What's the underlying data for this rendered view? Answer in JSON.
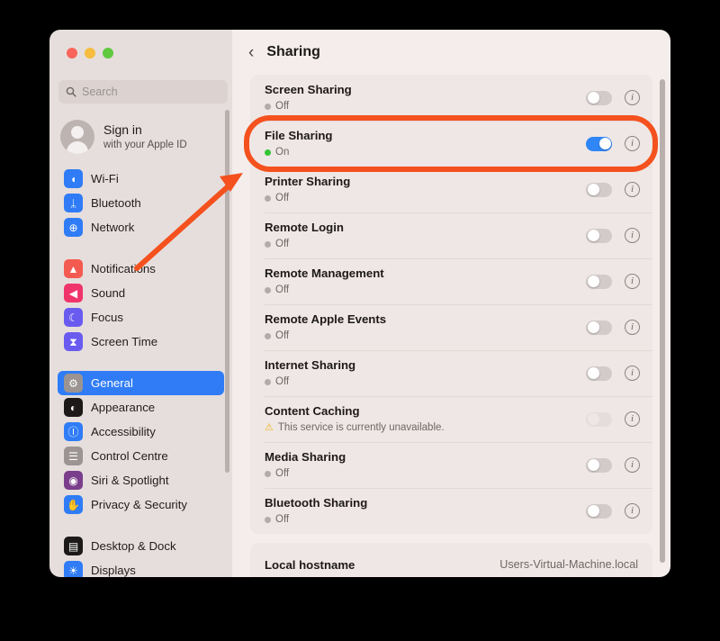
{
  "window": {
    "traffic_lights": [
      {
        "name": "close",
        "color": "#F9655B"
      },
      {
        "name": "minimize",
        "color": "#F6BD3E"
      },
      {
        "name": "zoom",
        "color": "#60C940"
      }
    ]
  },
  "sidebar": {
    "search": {
      "placeholder": "Search",
      "value": "",
      "icon": "search-icon"
    },
    "account": {
      "line1": "Sign in",
      "line2": "with your Apple ID",
      "icon": "avatar-placeholder-icon"
    },
    "groups": [
      {
        "items": [
          {
            "label": "Wi-Fi",
            "icon": "wifi-icon",
            "glyph": "◖",
            "bg": "#2F7CF6",
            "selected": false
          },
          {
            "label": "Bluetooth",
            "icon": "bluetooth-icon",
            "glyph": "ᛦ",
            "bg": "#2F7CF6",
            "selected": false
          },
          {
            "label": "Network",
            "icon": "network-icon",
            "glyph": "⊕",
            "bg": "#2F7CF6",
            "selected": false
          }
        ]
      },
      {
        "items": [
          {
            "label": "Notifications",
            "icon": "notifications-icon",
            "glyph": "▲",
            "bg": "#F45B50",
            "selected": false
          },
          {
            "label": "Sound",
            "icon": "sound-icon",
            "glyph": "◀",
            "bg": "#F0356B",
            "selected": false
          },
          {
            "label": "Focus",
            "icon": "focus-icon",
            "glyph": "☾",
            "bg": "#6A5BF0",
            "selected": false
          },
          {
            "label": "Screen Time",
            "icon": "screen-time-icon",
            "glyph": "⧗",
            "bg": "#6A5BF0",
            "selected": false
          }
        ]
      },
      {
        "items": [
          {
            "label": "General",
            "icon": "general-icon",
            "glyph": "⚙",
            "bg": "#9B9492",
            "selected": true
          },
          {
            "label": "Appearance",
            "icon": "appearance-icon",
            "glyph": "◐",
            "bg": "#1C1918",
            "selected": false
          },
          {
            "label": "Accessibility",
            "icon": "accessibility-icon",
            "glyph": "Ⓘ",
            "bg": "#2F7CF6",
            "selected": false
          },
          {
            "label": "Control Centre",
            "icon": "control-centre-icon",
            "glyph": "☰",
            "bg": "#9B9492",
            "selected": false
          },
          {
            "label": "Siri & Spotlight",
            "icon": "siri-icon",
            "glyph": "◉",
            "bg": "#7A3E8C",
            "selected": false
          },
          {
            "label": "Privacy & Security",
            "icon": "privacy-icon",
            "glyph": "✋",
            "bg": "#2F7CF6",
            "selected": false
          }
        ]
      },
      {
        "items": [
          {
            "label": "Desktop & Dock",
            "icon": "desktop-dock-icon",
            "glyph": "▤",
            "bg": "#1C1918",
            "selected": false
          },
          {
            "label": "Displays",
            "icon": "displays-icon",
            "glyph": "☀",
            "bg": "#2F7CF6",
            "selected": false
          }
        ]
      }
    ]
  },
  "main": {
    "back_button": "‹",
    "title": "Sharing",
    "services": [
      {
        "name": "Screen Sharing",
        "status": "Off",
        "state": "off",
        "toggle": "off"
      },
      {
        "name": "File Sharing",
        "status": "On",
        "state": "on",
        "toggle": "on"
      },
      {
        "name": "Printer Sharing",
        "status": "Off",
        "state": "off",
        "toggle": "off"
      },
      {
        "name": "Remote Login",
        "status": "Off",
        "state": "off",
        "toggle": "off"
      },
      {
        "name": "Remote Management",
        "status": "Off",
        "state": "off",
        "toggle": "off"
      },
      {
        "name": "Remote Apple Events",
        "status": "Off",
        "state": "off",
        "toggle": "off"
      },
      {
        "name": "Internet Sharing",
        "status": "Off",
        "state": "off",
        "toggle": "off"
      },
      {
        "name": "Content Caching",
        "status": "This service is currently unavailable.",
        "state": "warning",
        "toggle": "disabled"
      },
      {
        "name": "Media Sharing",
        "status": "Off",
        "state": "off",
        "toggle": "off"
      },
      {
        "name": "Bluetooth Sharing",
        "status": "Off",
        "state": "off",
        "toggle": "off"
      }
    ],
    "info_glyph": "i",
    "warning_glyph": "⚠",
    "hostname": {
      "label": "Local hostname",
      "value": "Users-Virtual-Machine.local"
    }
  },
  "annotations": {
    "highlight": {
      "shape": "rounded-rect",
      "target": "File Sharing",
      "color": "#F4511E"
    },
    "arrow": {
      "shape": "arrow",
      "from": "Notifications",
      "to": "File Sharing",
      "color": "#F4511E"
    }
  },
  "colors": {
    "accent": "#2F7CF6",
    "toggle_on": "#2F86F6",
    "status_on": "#34C434",
    "annotation": "#F4511E",
    "window_bg": "#F4EDEB",
    "sidebar_bg": "#E6DEDC"
  }
}
